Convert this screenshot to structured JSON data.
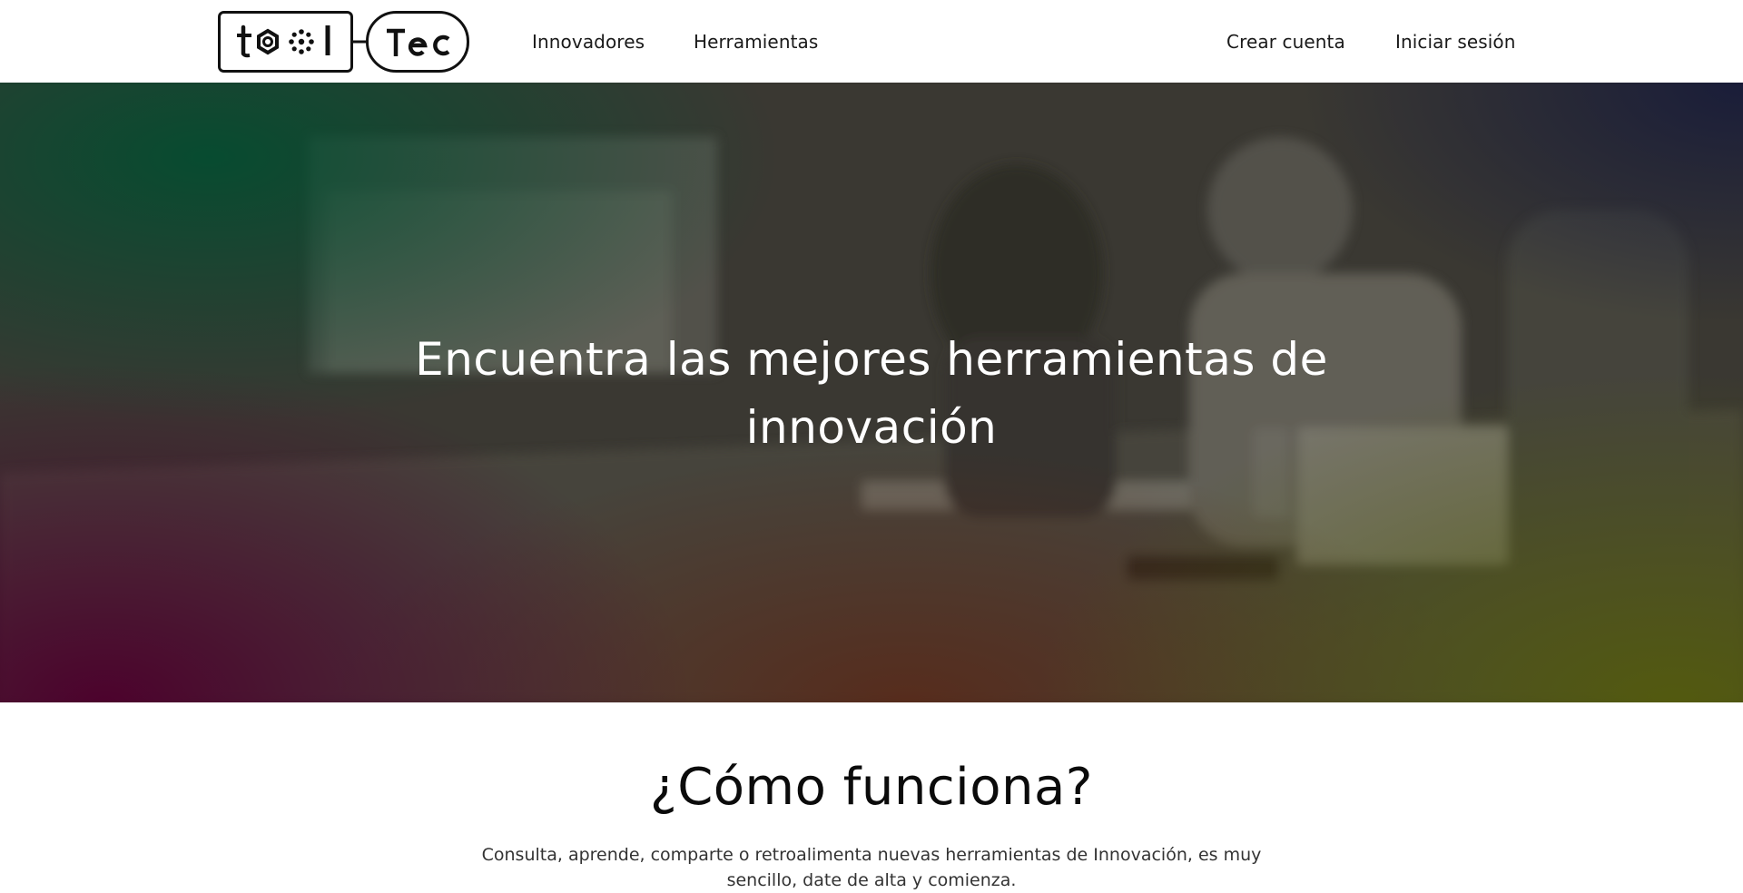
{
  "header": {
    "logo_icon": "tooltec-logo",
    "nav": {
      "innovadores": "Innovadores",
      "herramientas": "Herramientas"
    },
    "account": {
      "crear_cuenta": "Crear cuenta",
      "iniciar_sesion": "Iniciar sesión"
    }
  },
  "hero": {
    "title": "Encuentra las mejores herramientas de innovación",
    "overlay_colors": [
      "#004e30",
      "#4c002c",
      "#545c0a",
      "#161a3a",
      "#5c2412"
    ]
  },
  "how_it_works": {
    "title": "¿Cómo funciona?",
    "description": "Consulta, aprende, comparte o retroalimenta nuevas herramientas de Innovación, es muy sencillo, date de alta y comienza."
  }
}
